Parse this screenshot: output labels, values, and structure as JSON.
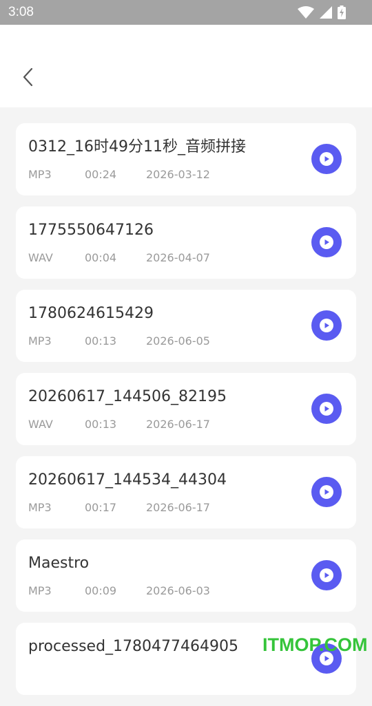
{
  "status_bar": {
    "time": "3:08",
    "icons": [
      "wifi-icon",
      "cell-signal-icon",
      "battery-charging-icon"
    ]
  },
  "header": {
    "back_icon": "chevron-left-icon"
  },
  "colors": {
    "accent": "#5a5bf1",
    "background": "#f4f4f4",
    "card": "#ffffff",
    "primary_text": "#333333",
    "secondary_text": "#9a9a9a",
    "status_bar": "#a4a4a4",
    "watermark": "#35c43a"
  },
  "audio_list": {
    "items": [
      {
        "name": "0312_16时49分11秒_音频拼接",
        "format": "MP3",
        "duration": "00:24",
        "date": "2026-03-12"
      },
      {
        "name": "1775550647126",
        "format": "WAV",
        "duration": "00:04",
        "date": "2026-04-07"
      },
      {
        "name": "1780624615429",
        "format": "MP3",
        "duration": "00:13",
        "date": "2026-06-05"
      },
      {
        "name": "20260617_144506_82195",
        "format": "WAV",
        "duration": "00:13",
        "date": "2026-06-17"
      },
      {
        "name": "20260617_144534_44304",
        "format": "MP3",
        "duration": "00:17",
        "date": "2026-06-17"
      },
      {
        "name": "Maestro",
        "format": "MP3",
        "duration": "00:09",
        "date": "2026-06-03"
      },
      {
        "name": "processed_1780477464905",
        "format": "",
        "duration": "",
        "date": ""
      }
    ],
    "play_icon": "play-icon"
  },
  "watermark": {
    "text": "ITMOP.COM"
  }
}
